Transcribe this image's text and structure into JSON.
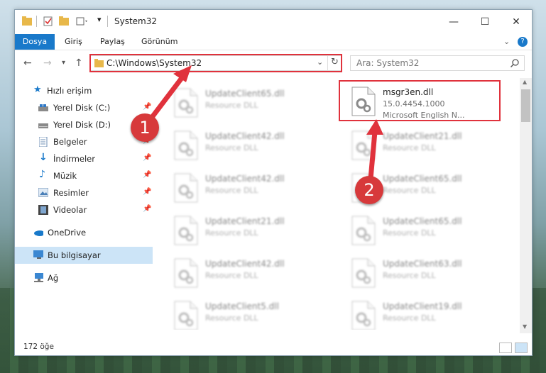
{
  "window": {
    "title": "System32",
    "minimize": "—",
    "maximize": "☐",
    "close": "✕"
  },
  "ribbon": {
    "tabs": [
      "Dosya",
      "Giriş",
      "Paylaş",
      "Görünüm"
    ],
    "expand": "⌄",
    "help": "?"
  },
  "address": {
    "path": "C:\\Windows\\System32",
    "search_placeholder": "Ara: System32"
  },
  "sidebar": {
    "items": [
      {
        "label": "Hızlı erişim"
      },
      {
        "label": "Yerel Disk (C:)"
      },
      {
        "label": "Yerel Disk (D:)"
      },
      {
        "label": "Belgeler"
      },
      {
        "label": "İndirmeler"
      },
      {
        "label": "Müzik"
      },
      {
        "label": "Resimler"
      },
      {
        "label": "Videolar"
      },
      {
        "label": "OneDrive"
      },
      {
        "label": "Bu bilgisayar"
      },
      {
        "label": "Ağ"
      }
    ]
  },
  "files": {
    "highlighted": {
      "name": "msgr3en.dll",
      "version": "15.0.4454.1000",
      "description": "Microsoft English N..."
    },
    "left_column": [
      {
        "name": "UpdateClient65.dll",
        "type": "Resource DLL"
      },
      {
        "name": "UpdateClient42.dll",
        "type": "Resource DLL"
      },
      {
        "name": "UpdateClient42.dll",
        "type": "Resource DLL"
      },
      {
        "name": "UpdateClient21.dll",
        "type": "Resource DLL"
      },
      {
        "name": "UpdateClient42.dll",
        "type": "Resource DLL"
      },
      {
        "name": "UpdateClient5.dll",
        "type": "Resource DLL"
      }
    ],
    "right_column": [
      {
        "name": "UpdateClient21.dll",
        "type": "Resource DLL"
      },
      {
        "name": "UpdateClient65.dll",
        "type": "Resource DLL"
      },
      {
        "name": "UpdateClient65.dll",
        "type": "Resource DLL"
      },
      {
        "name": "UpdateClient63.dll",
        "type": "Resource DLL"
      },
      {
        "name": "UpdateClient19.dll",
        "type": "Resource DLL"
      }
    ]
  },
  "status": {
    "count": "172 öğe"
  },
  "annotations": {
    "marker1": "1",
    "marker2": "2"
  },
  "colors": {
    "accent": "#1979ca",
    "highlight": "#e0323c"
  }
}
